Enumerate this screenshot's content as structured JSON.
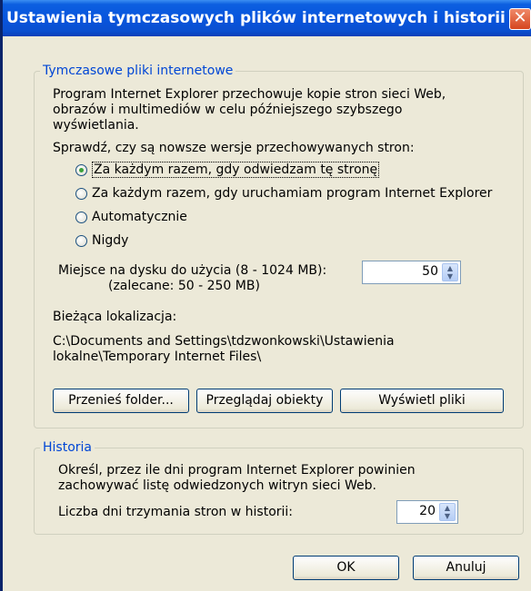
{
  "window": {
    "title": "Ustawienia tymczasowych plików internetowych i historii",
    "close_glyph": "✕"
  },
  "temp_files": {
    "legend": "Tymczasowe pliki internetowe",
    "description": [
      "Program Internet Explorer przechowuje kopie stron sieci Web,",
      "obrazów i multimediów w celu późniejszego szybszego",
      "wyświetlania."
    ],
    "check_label": "Sprawdź, czy są nowsze wersje przechowywanych stron:",
    "options": [
      {
        "label": "Za każdym razem, gdy odwiedzam tę stronę",
        "selected": true
      },
      {
        "label": "Za każdym razem, gdy uruchamiam program Internet Explorer",
        "selected": false
      },
      {
        "label": "Automatycznie",
        "selected": false
      },
      {
        "label": "Nigdy",
        "selected": false
      }
    ],
    "disk_label": "Miejsce na dysku do użycia (8 - 1024 MB):",
    "disk_hint": "(zalecane: 50 - 250 MB)",
    "disk_value": "50",
    "location_label": "Bieżąca lokalizacja:",
    "location_path": [
      "C:\\Documents and Settings\\tdzwonkowski\\Ustawienia",
      "lokalne\\Temporary Internet Files\\"
    ],
    "buttons": {
      "move": "Przenieś folder...",
      "view_objects": "Przeglądaj obiekty",
      "view_files": "Wyświetl pliki"
    }
  },
  "history": {
    "legend": "Historia",
    "description": [
      "Określ, przez ile dni program Internet Explorer powinien",
      "zachowywać listę odwiedzonych witryn sieci Web."
    ],
    "days_label": "Liczba dni trzymania stron w historii:",
    "days_value": "20"
  },
  "footer": {
    "ok": "OK",
    "cancel": "Anuluj"
  },
  "icons": {
    "spin_up": "▲",
    "spin_down": "▼"
  }
}
